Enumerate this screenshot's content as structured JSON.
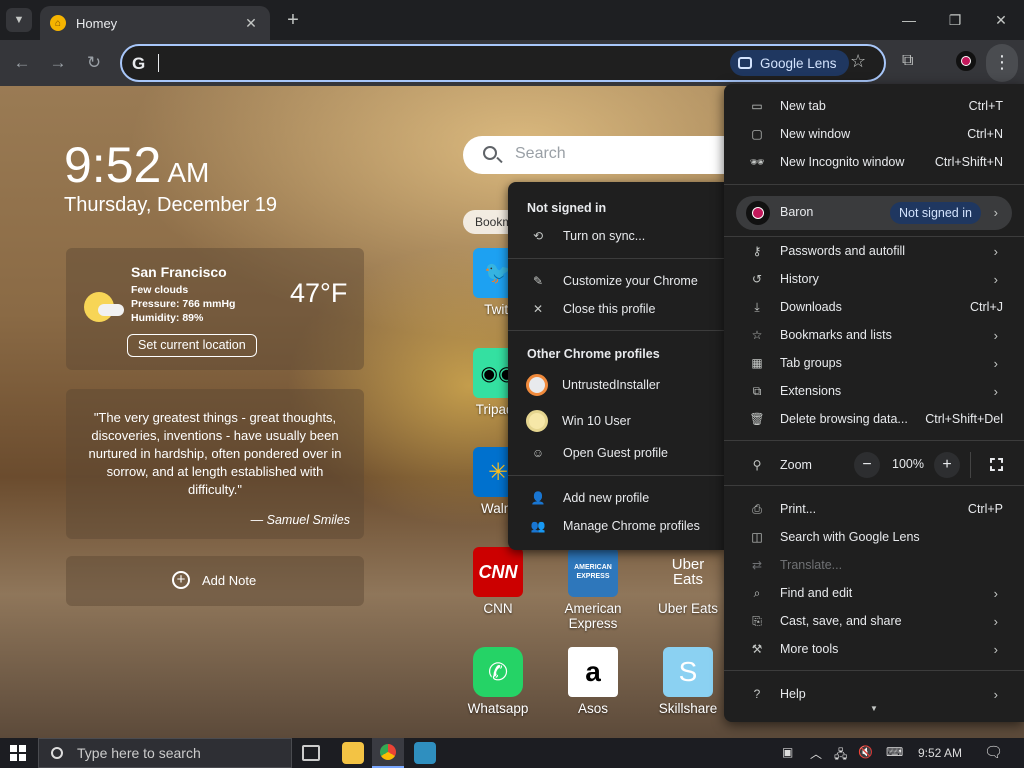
{
  "tab": {
    "title": "Homey"
  },
  "omnibox": {
    "value": "",
    "lens_label": "Google Lens"
  },
  "ntp": {
    "time": "9:52",
    "ampm": "AM",
    "date": "Thursday, December 19",
    "search_placeholder": "Search",
    "bookmarks_tab": "Bookm",
    "weather": {
      "city": "San Francisco",
      "condition": "Few clouds",
      "pressure": "Pressure: 766 mmHg",
      "humidity": "Humidity: 89%",
      "temp": "47°F",
      "button": "Set current location"
    },
    "quote": {
      "text": "\"The very greatest things - great thoughts, discoveries, inventions - have usually been nurtured in hardship, often pondered over in sorrow, and at length established with difficulty.\"",
      "author": "— Samuel Smiles"
    },
    "add_note": "Add Note",
    "tiles": [
      {
        "label": "Twitt",
        "icon": "twitter-icon"
      },
      {
        "label": "Tripadv",
        "icon": "tripadvisor-icon"
      },
      {
        "label": "Walm",
        "icon": "walmart-icon"
      },
      {
        "label": "CNN",
        "icon": "cnn-icon"
      },
      {
        "label": "American Express",
        "icon": "amex-icon",
        "icon_text": "AMERICAN EXPRESS"
      },
      {
        "label": "Uber Eats",
        "icon": "uber-eats-icon",
        "icon_text": "Uber Eats"
      },
      {
        "label": "Whatsapp",
        "icon": "whatsapp-icon"
      },
      {
        "label": "Asos",
        "icon": "asos-icon",
        "icon_text": "a"
      },
      {
        "label": "Skillshare",
        "icon": "skillshare-icon",
        "icon_text": "S"
      }
    ]
  },
  "profile_menu": {
    "header_signed": "Not signed in",
    "turn_on_sync": "Turn on sync...",
    "customize": "Customize your Chrome",
    "close_profile": "Close this profile",
    "other_header": "Other Chrome profiles",
    "profiles": [
      "UntrustedInstaller",
      "Win 10 User"
    ],
    "guest": "Open Guest profile",
    "add_profile": "Add new profile",
    "manage_profiles": "Manage Chrome profiles"
  },
  "chrome_menu": {
    "new_tab": {
      "label": "New tab",
      "shortcut": "Ctrl+T"
    },
    "new_window": {
      "label": "New window",
      "shortcut": "Ctrl+N"
    },
    "incognito": {
      "label": "New Incognito window",
      "shortcut": "Ctrl+Shift+N"
    },
    "profile": {
      "name": "Baron",
      "badge": "Not signed in"
    },
    "passwords": "Passwords and autofill",
    "history": "History",
    "downloads": {
      "label": "Downloads",
      "shortcut": "Ctrl+J"
    },
    "bookmarks": "Bookmarks and lists",
    "tab_groups": "Tab groups",
    "extensions": "Extensions",
    "delete_data": {
      "label": "Delete browsing data...",
      "shortcut": "Ctrl+Shift+Del"
    },
    "zoom": {
      "label": "Zoom",
      "value": "100%"
    },
    "print": {
      "label": "Print...",
      "shortcut": "Ctrl+P"
    },
    "search_lens": "Search with Google Lens",
    "translate": "Translate...",
    "find_edit": "Find and edit",
    "cast": "Cast, save, and share",
    "more_tools": "More tools",
    "help": "Help"
  },
  "taskbar": {
    "search_placeholder": "Type here to search",
    "time": "9:52 AM"
  }
}
